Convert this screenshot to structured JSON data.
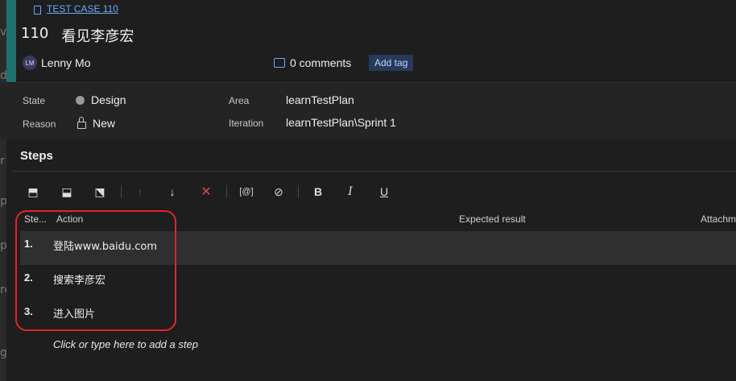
{
  "left_strip": [
    "vi",
    "ds",
    "r",
    "p",
    "p",
    "re",
    "g"
  ],
  "header": {
    "case_link": "TEST CASE 110",
    "id": "110",
    "title": "看见李彦宏",
    "avatar_initials": "LM",
    "user": "Lenny Mo",
    "comments": "0 comments",
    "add_tag": "Add tag"
  },
  "fields": {
    "state_label": "State",
    "state_value": "Design",
    "reason_label": "Reason",
    "reason_value": "New",
    "area_label": "Area",
    "area_value": "learnTestPlan",
    "iteration_label": "Iteration",
    "iteration_value": "learnTestPlan\\Sprint 1"
  },
  "steps": {
    "title": "Steps",
    "columns": {
      "step": "Ste...",
      "action": "Action",
      "expected": "Expected result",
      "attachments": "Attachm"
    },
    "rows": [
      {
        "num": "1.",
        "action": "登陆www.baidu.com"
      },
      {
        "num": "2.",
        "action": "搜索李彦宏"
      },
      {
        "num": "3.",
        "action": "进入图片"
      }
    ],
    "add_step": "Click or type here to add a step"
  },
  "toolbar": {
    "insert_step": "⬒",
    "insert_shared": "⬓",
    "create_shared": "⬔",
    "move_up": "↑",
    "move_down": "↓",
    "delete": "✕",
    "parameter": "[@]",
    "attach": "⊘",
    "bold": "B",
    "italic": "I",
    "underline": "U"
  },
  "colors": {
    "accent": "#1f6f6f",
    "link": "#6fa8ff",
    "annotation": "#e0252a",
    "delete": "#e04646"
  }
}
